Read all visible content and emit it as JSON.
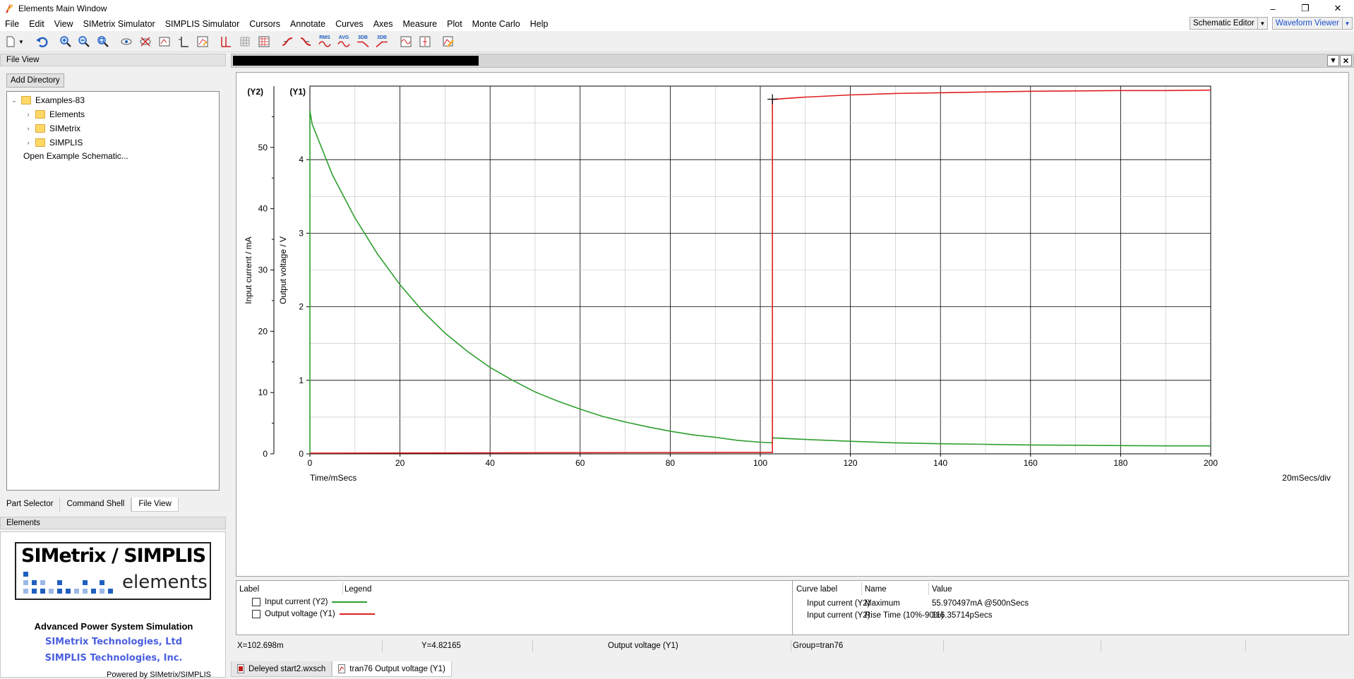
{
  "window": {
    "title": "Elements Main Window",
    "controls": [
      "–",
      "❐",
      "✕"
    ]
  },
  "menu": [
    "File",
    "Edit",
    "View",
    "SIMetrix Simulator",
    "SIMPLIS Simulator",
    "Cursors",
    "Annotate",
    "Curves",
    "Axes",
    "Measure",
    "Plot",
    "Monte Carlo",
    "Help"
  ],
  "combos": {
    "editor": "Schematic Editor",
    "viewer": "Waveform Viewer"
  },
  "toolbar_labels": {
    "rms": "RMS",
    "avg": "AVG",
    "db1": "3DB",
    "db2": "3DB"
  },
  "left": {
    "file_view_title": "File View",
    "add_directory": "Add Directory",
    "tree": {
      "root": "Examples-83",
      "children": [
        "Elements",
        "SIMetrix",
        "SIMPLIS"
      ],
      "action": "Open Example Schematic..."
    },
    "tabs": [
      "Part Selector",
      "Command Shell",
      "File View"
    ],
    "elements_title": "Elements",
    "logo_top": "SIMetrix / SIMPLIS",
    "logo_bottom": "elements",
    "tagline": "Advanced Power System Simulation",
    "company1": "SIMetrix Technologies, Ltd",
    "company2": "SIMPLIS Technologies, Inc.",
    "powered": "Powered by SIMetrix/SIMPLIS"
  },
  "plot": {
    "y2_tag": "(Y2)",
    "y1_tag": "(Y1)",
    "y2_label": "Input current / mA",
    "y1_label": "Output voltage / V",
    "x_label": "Time/mSecs",
    "x_div": "20mSecs/div"
  },
  "chart_data": {
    "type": "line",
    "xlabel": "Time/mSecs",
    "x_ticks": [
      0,
      20,
      40,
      60,
      80,
      100,
      120,
      140,
      160,
      180,
      200
    ],
    "xlim": [
      0,
      200
    ],
    "y1": {
      "label": "Output voltage / V",
      "ticks": [
        0,
        1,
        2,
        3,
        4
      ],
      "ylim": [
        0,
        5
      ]
    },
    "y2": {
      "label": "Input current / mA",
      "ticks": [
        0,
        10,
        20,
        30,
        40,
        50
      ],
      "ylim": [
        0,
        60
      ]
    },
    "series": [
      {
        "name": "Input current (Y2)",
        "axis": "y2",
        "color": "#2e9e2e",
        "x": [
          0,
          0,
          0.5,
          5,
          10,
          15,
          20,
          25,
          30,
          35,
          40,
          45,
          50,
          55,
          60,
          65,
          70,
          75,
          80,
          85,
          90,
          95,
          100,
          102.7,
          102.7,
          110,
          120,
          130,
          140,
          150,
          160,
          170,
          180,
          190,
          200
        ],
        "y": [
          0,
          55.97,
          53.8,
          45.5,
          38.5,
          32.6,
          27.6,
          23.3,
          19.7,
          16.7,
          14.1,
          12.0,
          10.1,
          8.6,
          7.3,
          6.1,
          5.2,
          4.4,
          3.7,
          3.1,
          2.7,
          2.2,
          1.9,
          1.8,
          2.6,
          2.35,
          2.05,
          1.8,
          1.65,
          1.55,
          1.45,
          1.4,
          1.35,
          1.3,
          1.3
        ]
      },
      {
        "name": "Output voltage (Y1)",
        "axis": "y1",
        "color": "#e02020",
        "x": [
          0,
          102.5,
          102.7,
          102.7,
          110,
          120,
          130,
          140,
          150,
          160,
          170,
          180,
          190,
          200
        ],
        "y": [
          0.01,
          0.02,
          0.02,
          4.82,
          4.85,
          4.88,
          4.9,
          4.91,
          4.92,
          4.93,
          4.935,
          4.94,
          4.94,
          4.945
        ]
      }
    ],
    "cursor": {
      "x": 102.698,
      "y": 4.82165
    },
    "grid": true
  },
  "legend": {
    "col_label": "Label",
    "col_legend": "Legend",
    "items": [
      {
        "label": "Input current (Y2)",
        "color": "#2e9e2e"
      },
      {
        "label": "Output voltage (Y1)",
        "color": "#e02020"
      }
    ]
  },
  "measurements": {
    "col_curve": "Curve label",
    "col_name": "Name",
    "col_value": "Value",
    "rows": [
      {
        "curve": "Input current (Y2)",
        "name": "Maximum",
        "value": "55.970497mA @500nSecs"
      },
      {
        "curve": "Input current (Y2)",
        "name": "Rise Time (10%-90%)",
        "value": "116.35714pSecs"
      }
    ]
  },
  "status": {
    "x": "X=102.698m",
    "y": "Y=4.82165",
    "curve": "Output voltage (Y1)",
    "group": "Group=tran76"
  },
  "doc_tabs": [
    "Deleyed start2.wxsch",
    "tran76 Output voltage (Y1)"
  ]
}
